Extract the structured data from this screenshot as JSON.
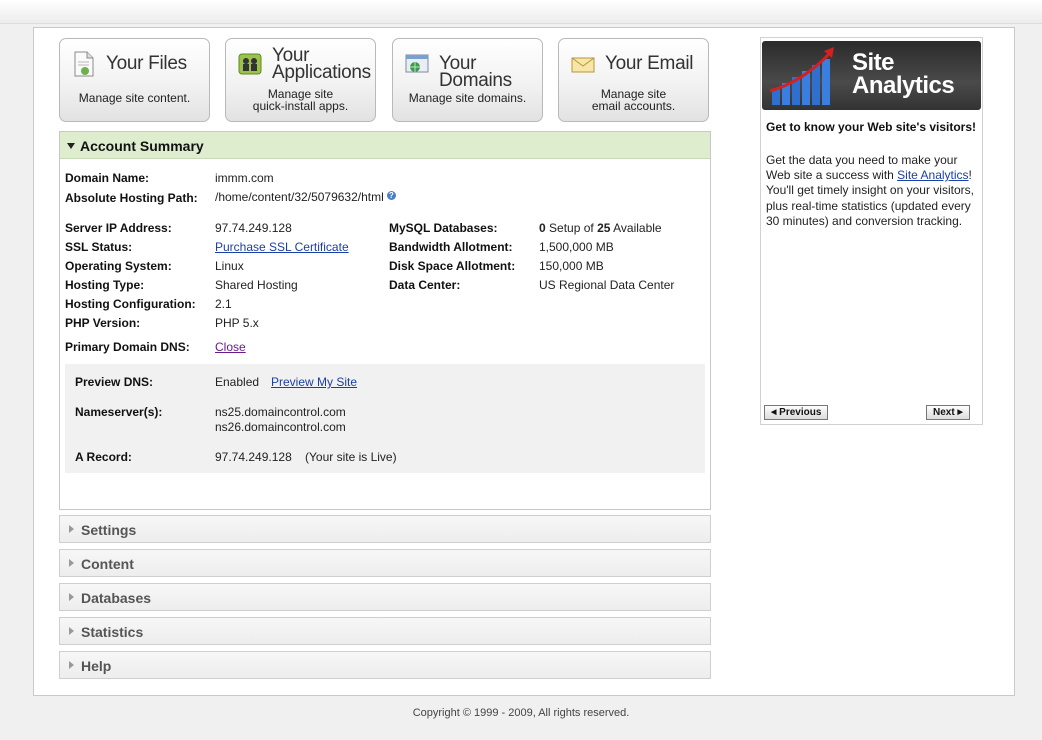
{
  "tiles": [
    {
      "title": "Your Files",
      "desc1": "Manage site content.",
      "desc2": "",
      "icon": "files-icon"
    },
    {
      "title1": "Your",
      "title2": "Applications",
      "desc1": "Manage site",
      "desc2": "quick-install apps.",
      "icon": "applications-icon"
    },
    {
      "title": "Your Domains",
      "desc1": "Manage site domains.",
      "desc2": "",
      "icon": "domains-icon"
    },
    {
      "title": "Your Email",
      "desc1": "Manage site",
      "desc2": "email accounts.",
      "icon": "email-icon"
    }
  ],
  "account": {
    "title": "Account Summary",
    "domain_name_label": "Domain Name:",
    "domain_name": "immm.com",
    "path_label": "Absolute Hosting Path:",
    "path": "/home/content/32/5079632/html",
    "ip_label": "Server IP Address:",
    "ip": "97.74.249.128",
    "ssl_label": "SSL Status:",
    "ssl_link": "Purchase SSL Certificate",
    "os_label": "Operating System:",
    "os": "Linux",
    "hosting_type_label": "Hosting Type:",
    "hosting_type": "Shared Hosting",
    "hosting_config_label": "Hosting Configuration:",
    "hosting_config": "2.1",
    "php_label": "PHP Version:",
    "php": "PHP 5.x",
    "mysql_label": "MySQL Databases:",
    "mysql_used": "0",
    "mysql_mid": "Setup of",
    "mysql_total": "25",
    "mysql_tail": "Available",
    "bandwidth_label": "Bandwidth Allotment:",
    "bandwidth": "1,500,000 MB",
    "disk_label": "Disk Space Allotment:",
    "disk": "150,000 MB",
    "datacenter_label": "Data Center:",
    "datacenter": "US Regional Data Center",
    "dns_label": "Primary Domain DNS:",
    "dns_toggle": "Close",
    "preview_label": "Preview DNS:",
    "preview_status": "Enabled",
    "preview_link": "Preview My Site",
    "ns_label": "Nameserver(s):",
    "ns1": "ns25.domaincontrol.com",
    "ns2": "ns26.domaincontrol.com",
    "arecord_label": "A Record:",
    "arecord": "97.74.249.128",
    "arecord_note": "(Your site is Live)"
  },
  "panels": [
    "Settings",
    "Content",
    "Databases",
    "Statistics",
    "Help"
  ],
  "ad": {
    "title1": "Site",
    "title2": "Analytics",
    "heading": "Get to know your Web site's visitors!",
    "body_pre": "Get the data you need to make your Web site a success with",
    "body_link": "Site Analytics",
    "body_post": "! You'll get timely insight on your visitors, plus real-time statistics (updated every 30 minutes) and conversion tracking.",
    "prev": "Previous",
    "next": "Next"
  },
  "footer": {
    "copyright": "Copyright © 1999 - 2009, All rights reserved."
  },
  "colors": {
    "accent_green": "#dfedcf",
    "link": "#1a3fa8",
    "visited_link": "#6b1a8e"
  }
}
